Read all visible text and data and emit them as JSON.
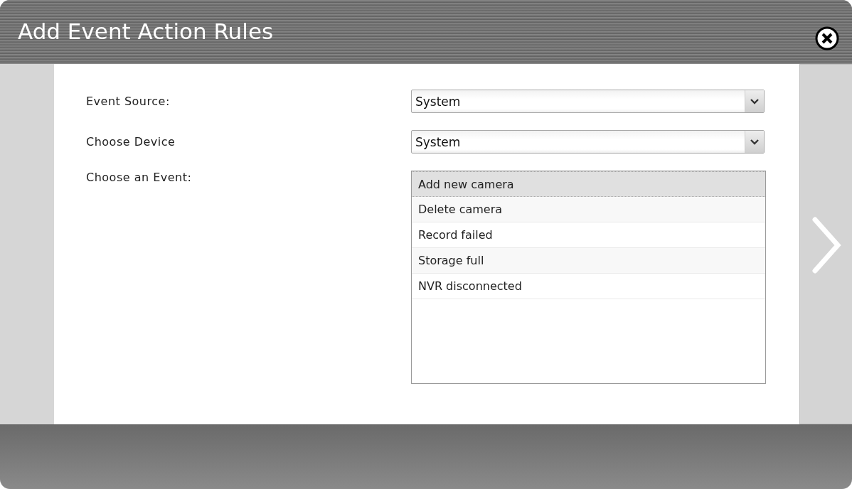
{
  "window": {
    "title": "Add Event Action Rules"
  },
  "fields": [
    {
      "label": "Event Source:",
      "value": "System"
    },
    {
      "label": "Choose Device",
      "value": "System"
    }
  ],
  "event_list": {
    "label": "Choose an Event:",
    "items": [
      {
        "text": "Add new camera",
        "selected": true
      },
      {
        "text": "Delete camera",
        "selected": false
      },
      {
        "text": "Record failed",
        "selected": false
      },
      {
        "text": "Storage full",
        "selected": false
      },
      {
        "text": "NVR disconnected",
        "selected": false
      }
    ]
  }
}
